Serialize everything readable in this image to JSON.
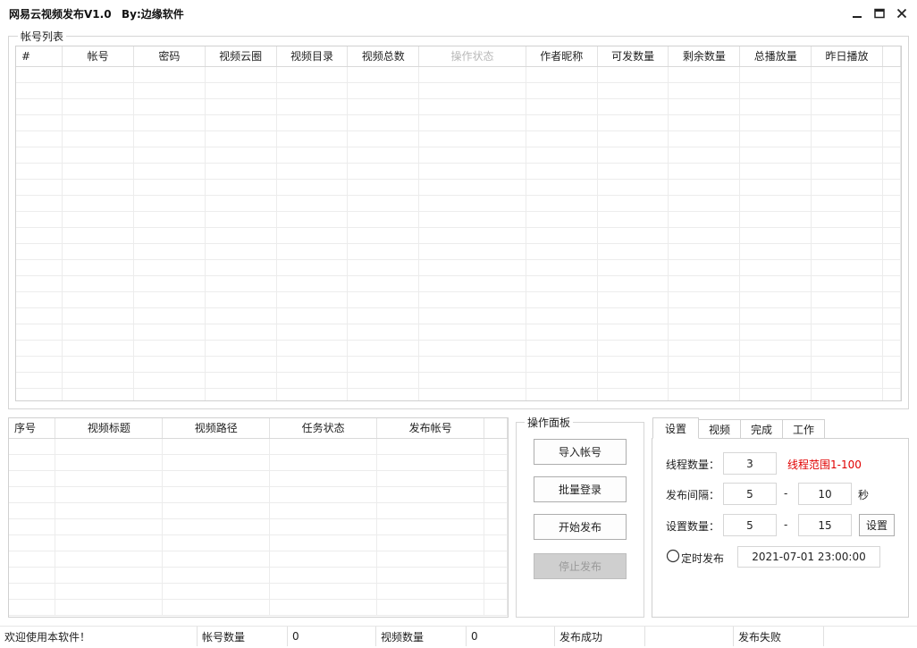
{
  "window": {
    "title": "网易云视频发布V1.0",
    "byline": "By:边缘软件"
  },
  "account_list": {
    "group_title": "帐号列表",
    "columns": [
      "#",
      "帐号",
      "密码",
      "视频云圈",
      "视频目录",
      "视频总数",
      "操作状态",
      "作者昵称",
      "可发数量",
      "剩余数量",
      "总播放量",
      "昨日播放"
    ]
  },
  "task_list": {
    "columns": [
      "序号",
      "视频标题",
      "视频路径",
      "任务状态",
      "发布帐号"
    ]
  },
  "ops_panel": {
    "title": "操作面板",
    "import_label": "导入帐号",
    "batch_login_label": "批量登录",
    "start_label": "开始发布",
    "stop_label": "停止发布"
  },
  "tabs": [
    "设置",
    "视频",
    "完成",
    "工作"
  ],
  "settings": {
    "thread_label": "线程数量：",
    "thread_value": "3",
    "thread_hint": "线程范围1-100",
    "interval_label": "发布间隔：",
    "interval_min": "5",
    "interval_dash": "-",
    "interval_max": "10",
    "interval_unit": "秒",
    "count_label": "设置数量：",
    "count_min": "5",
    "count_dash": "-",
    "count_max": "15",
    "count_button": "设置",
    "schedule_label": "定时发布",
    "schedule_value": "2021-07-01 23:00:00"
  },
  "status_bar": {
    "welcome": "欢迎使用本软件！",
    "account_count_label": "帐号数量",
    "account_count_value": "0",
    "video_count_label": "视频数量",
    "video_count_value": "0",
    "success_label": "发布成功",
    "success_value": "",
    "fail_label": "发布失败",
    "fail_value": ""
  }
}
